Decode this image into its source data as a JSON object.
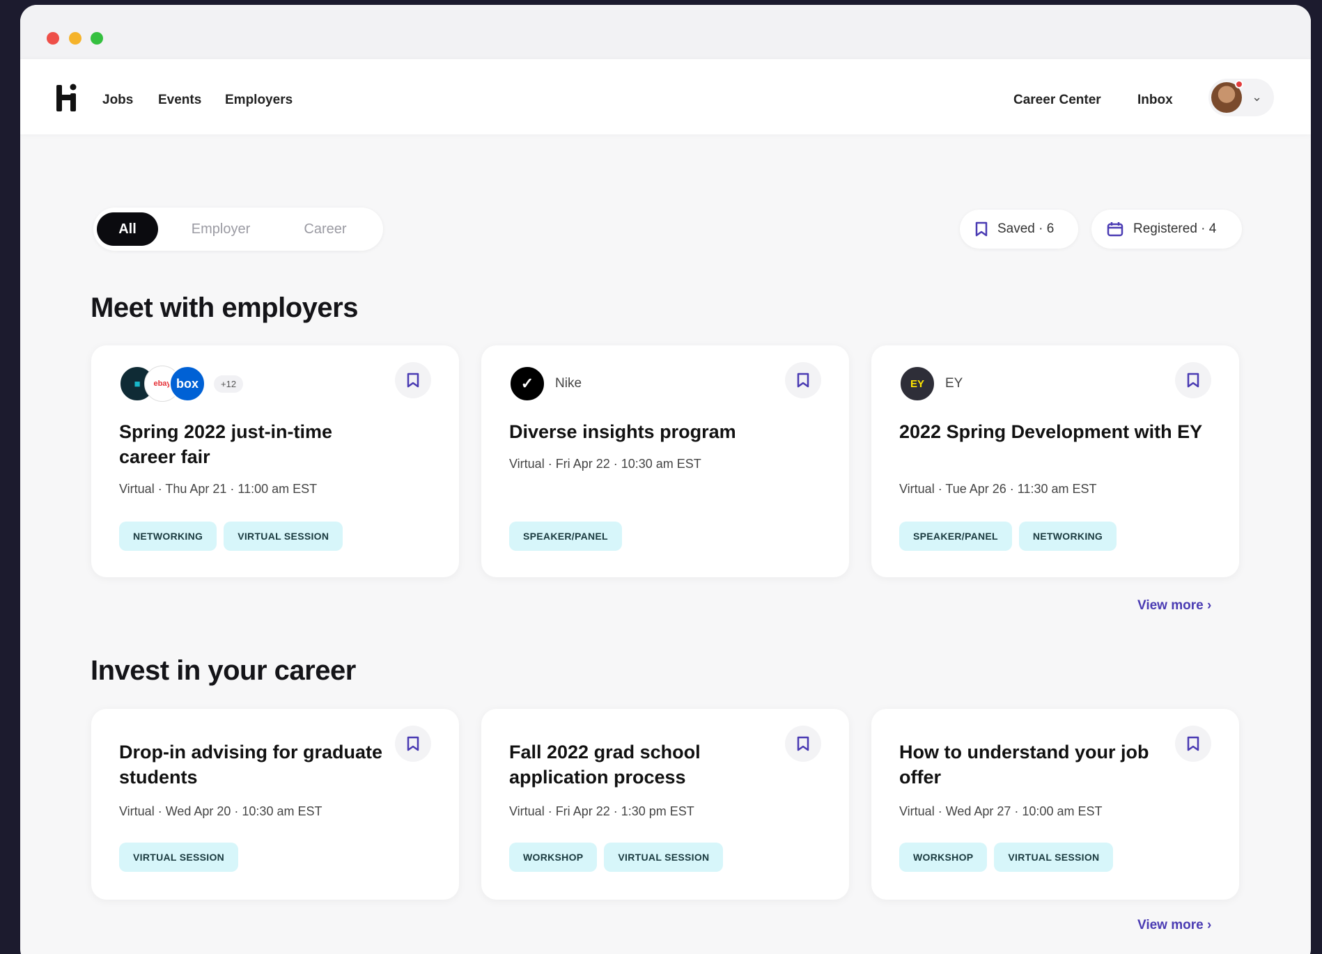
{
  "nav": {
    "links": [
      "Jobs",
      "Events",
      "Employers"
    ],
    "right_links": [
      "Career Center",
      "Inbox"
    ]
  },
  "filters": {
    "segments": [
      "All",
      "Employer",
      "Career"
    ],
    "active": "All",
    "saved_label": "Saved · 6",
    "registered_label": "Registered · 4"
  },
  "sections": [
    {
      "title": "Meet with employers",
      "view_more": "View more ›",
      "cards": [
        {
          "employer_logos": [
            "box-logo",
            "ebay",
            "box"
          ],
          "employer_extra": "+12",
          "title": "Spring 2022 just-in-time career fair",
          "meta": "Virtual · Thu Apr 21 · 11:00 am EST",
          "tags": [
            "NETWORKING",
            "VIRTUAL SESSION"
          ]
        },
        {
          "employer": "Nike",
          "title": "Diverse insights program",
          "meta": "Virtual · Fri Apr 22 · 10:30 am EST",
          "tags": [
            "SPEAKER/PANEL"
          ]
        },
        {
          "employer": "EY",
          "title": "2022 Spring Development with EY",
          "meta": "Virtual · Tue Apr 26 · 11:30 am EST",
          "tags": [
            "SPEAKER/PANEL",
            "NETWORKING"
          ]
        }
      ]
    },
    {
      "title": "Invest in your career",
      "view_more": "View more ›",
      "cards": [
        {
          "title": "Drop-in advising for graduate students",
          "meta": "Virtual · Wed Apr 20 · 10:30 am EST",
          "tags": [
            "VIRTUAL SESSION"
          ]
        },
        {
          "title": "Fall 2022 grad school application process",
          "meta": "Virtual · Fri Apr 22 · 1:30 pm EST",
          "tags": [
            "WORKSHOP",
            "VIRTUAL SESSION"
          ]
        },
        {
          "title": "How to understand your job offer",
          "meta": "Virtual · Wed Apr 27 · 10:00 am EST",
          "tags": [
            "WORKSHOP",
            "VIRTUAL SESSION"
          ]
        }
      ]
    }
  ],
  "colors": {
    "accent": "#4a3bb3",
    "tag_bg": "#d7f6fa",
    "active_segment": "#0b0b0f"
  }
}
